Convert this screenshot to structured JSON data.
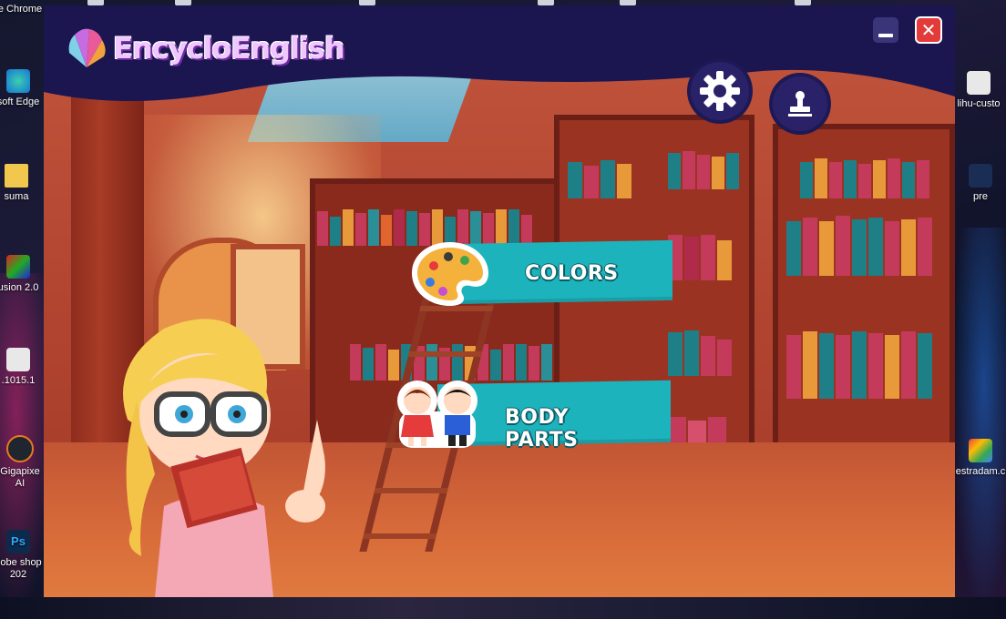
{
  "desktop": {
    "icons": [
      {
        "label": "e Chrome"
      },
      {
        "label": "soft Edge"
      },
      {
        "label": "suma"
      },
      {
        "label": "usion 2.0"
      },
      {
        "label": ".1015.1"
      },
      {
        "label": "Gigapixe AI"
      },
      {
        "label": "dobe shop 202"
      },
      {
        "label": "lihu-custo"
      },
      {
        "label": "pre"
      },
      {
        "label": "estradam.c"
      }
    ]
  },
  "app": {
    "title": "EncycloEnglish",
    "window_controls": {
      "minimize": "",
      "close": "✕"
    },
    "toolbar": {
      "settings_icon": "gear-icon",
      "stamp_icon": "stamp-icon"
    },
    "menu": [
      {
        "label": "COLORS",
        "icon": "palette-icon"
      },
      {
        "label": "BODY PARTS",
        "icon": "kids-icon"
      }
    ],
    "colors": {
      "header": "#1b1550",
      "menu_button": "#1db3bd",
      "close": "#e33a3a"
    }
  }
}
